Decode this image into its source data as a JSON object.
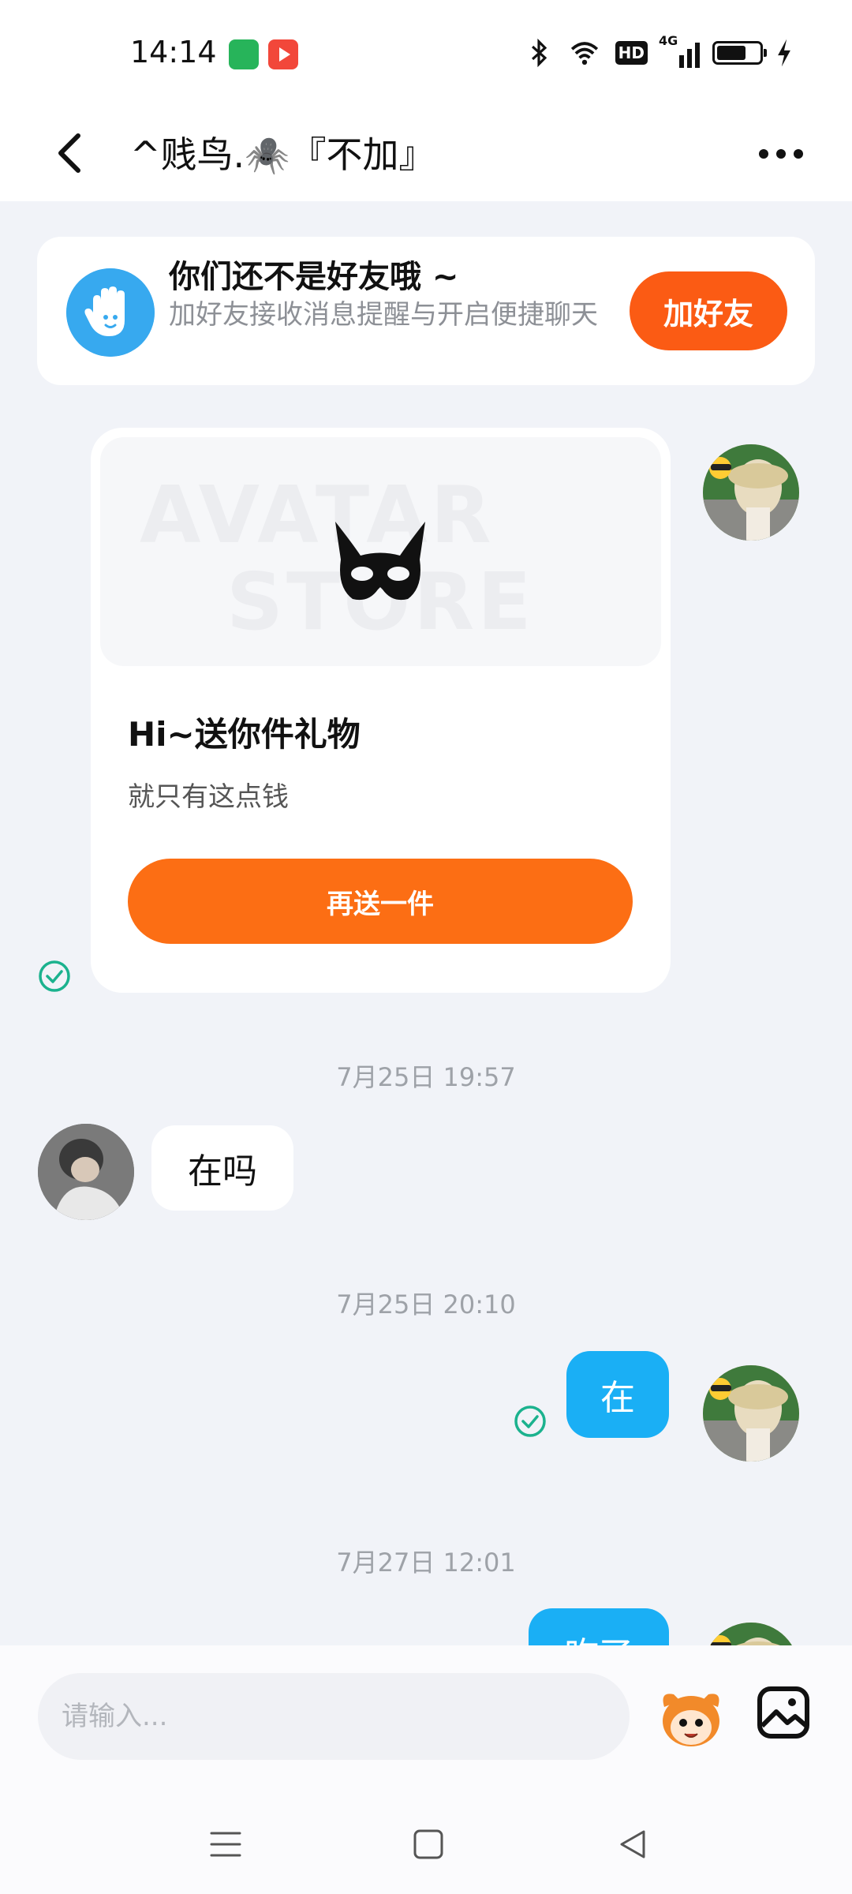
{
  "status_bar": {
    "time": "14:14",
    "network": "4G",
    "hd_badge": "HD"
  },
  "header": {
    "title": "^贱鸟.🕷️『不加』"
  },
  "friend_banner": {
    "title": "你们还不是好友哦 ~",
    "subtitle": "加好友接收消息提醒与开启便捷聊天",
    "button_label": "加好友"
  },
  "gift_card": {
    "watermark_line1": "AVATAR",
    "watermark_line2": "STORE",
    "title": "Hi~送你件礼物",
    "subtitle": "就只有这点钱",
    "button_label": "再送一件"
  },
  "messages": [
    {
      "timestamp": "7月25日 19:57",
      "direction": "incoming",
      "text": "在吗"
    },
    {
      "timestamp": "7月25日 20:10",
      "direction": "outgoing",
      "text": "在"
    },
    {
      "timestamp": "7月27日 12:01",
      "direction": "outgoing",
      "text": "咋了"
    }
  ],
  "composer": {
    "placeholder": "请输入..."
  },
  "colors": {
    "accent_orange": "#fb5b14",
    "outgoing_bubble": "#1aaff5",
    "read_check": "#1bb28e"
  }
}
